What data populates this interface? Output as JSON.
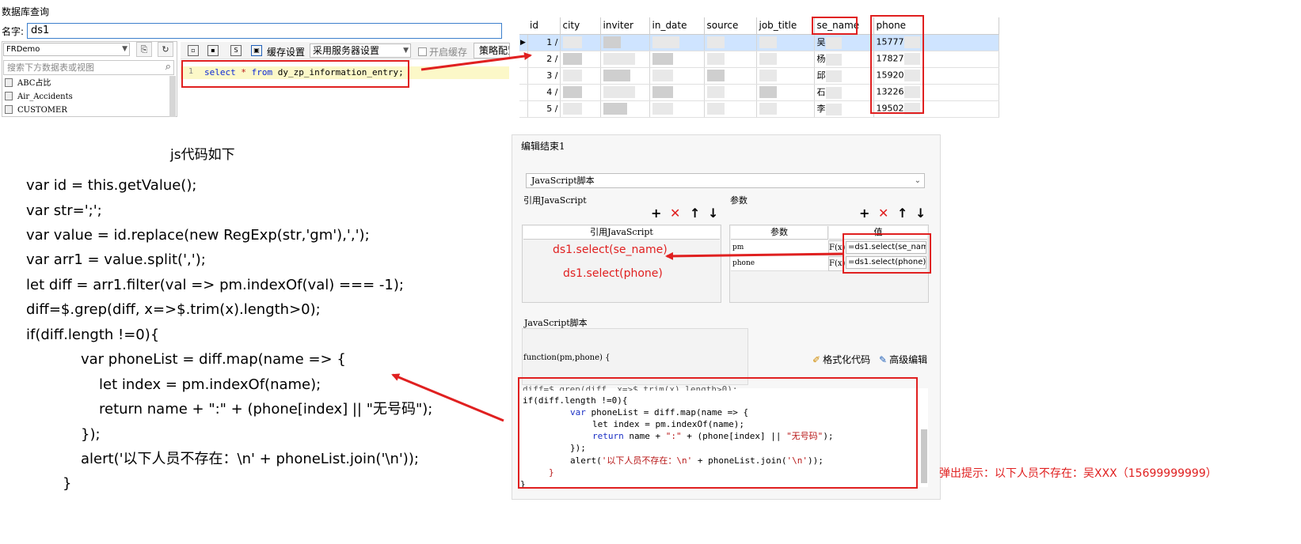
{
  "query_panel": {
    "title": "数据库查询",
    "name_label": "名字:",
    "name_value": "ds1",
    "db_select": "FRDemo",
    "search_placeholder": "搜索下方数据表或视图",
    "tables": [
      "ABC占比",
      "Air_Accidents",
      "CUSTOMER"
    ],
    "toolbar": {
      "cache_settings": "缓存设置",
      "server_setting": "采用服务器设置",
      "open_cache": "开启缓存",
      "policy": "策略配置"
    },
    "line_number": "1",
    "sql": {
      "kw1": "select",
      "star": " * ",
      "kw2": "from",
      "rest": " dy_zp_information_entry;"
    }
  },
  "result_table": {
    "columns": [
      "id",
      "city",
      "inviter",
      "in_date",
      "source",
      "job_title",
      "se_name",
      "phone"
    ],
    "rows": [
      {
        "id": "1",
        "city": "/",
        "name": "吴",
        "phone": "15777"
      },
      {
        "id": "2",
        "city": "/",
        "name": "杨",
        "phone": "17827"
      },
      {
        "id": "3",
        "city": "/",
        "name": "邱",
        "phone": "15920"
      },
      {
        "id": "4",
        "city": "/",
        "name": "石",
        "phone": "13226"
      },
      {
        "id": "5",
        "city": "/",
        "name": "李",
        "phone": "19502"
      }
    ]
  },
  "js_code": {
    "caption": "js代码如下",
    "lines": [
      "var id = this.getValue();",
      "var str=';';",
      "var value = id.replace(new RegExp(str,'gm'),',');",
      "var arr1 = value.split(',');",
      "let diff = arr1.filter(val => pm.indexOf(val) === -1);",
      "diff=$.grep(diff, x=>$.trim(x).length>0);",
      "if(diff.length !=0){",
      "var phoneList = diff.map(name => {",
      "let index = pm.indexOf(name);",
      "return name + \":\" + (phone[index] || \"无号码\");",
      "});",
      "alert('以下人员不存在：\\n' + phoneList.join('\\n'));",
      "}"
    ]
  },
  "dialog": {
    "title": "编辑结束1",
    "script_type": "JavaScript脚本",
    "ref_js_label": "引用JavaScript",
    "params_label": "参数",
    "ref_js_header": "引用JavaScript",
    "param_header": "参数",
    "value_header": "值",
    "params": [
      {
        "name": "pm",
        "fx": "F(x)",
        "value": "=ds1.select(se_name)"
      },
      {
        "name": "phone",
        "fx": "F(x)",
        "value": "=ds1.select(phone)"
      }
    ],
    "annotations": [
      "ds1.select(se_name)",
      "ds1.select(phone)"
    ],
    "js_script_label": "JavaScript脚本",
    "fn_signature": "function(pm,phone) {",
    "format_code": "格式化代码",
    "advanced_edit": "高级编辑",
    "editor": {
      "l0": "diff=$.grep(diff, x=>$.trim(x).length>0);",
      "l1": "if(diff.length !=0){",
      "l2_kw": "var",
      "l2_rest": " phoneList = diff.map(name => {",
      "l3": "let index = pm.indexOf(name);",
      "l4_kw": "return",
      "l4_a": " name + ",
      "l4_s1": "\":\"",
      "l4_b": " + (phone[index] || ",
      "l4_s2": "\"无号码\"",
      "l4_c": ");",
      "l5": "});",
      "l6_a": "alert(",
      "l6_s": "'以下人员不存在：\\n'",
      "l6_b": " + phoneList.join(",
      "l6_s2": "'\\n'",
      "l6_c": "));",
      "l7": "}",
      "l8": "}"
    },
    "popup_message": "弹出提示：以下人员不存在：吴XXX（15699999999）"
  },
  "colors": {
    "annotation_red": "#e02020",
    "keyword_blue": "#1a2fc4"
  }
}
